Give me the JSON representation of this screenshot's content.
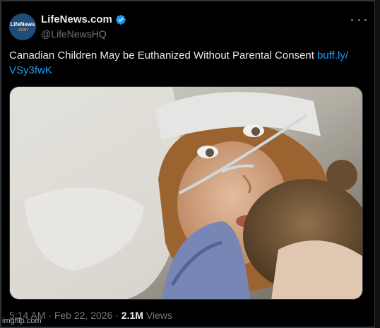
{
  "author": {
    "display_name": "LifeNews.com",
    "handle": "@LifeNewsHQ",
    "avatar_line1": "LifeNews",
    "avatar_line2": ".com",
    "verified_icon": "verified-badge-icon",
    "verified_color": "#1d9bf0"
  },
  "tweet": {
    "text": "Canadian Children May be Euthanized Without Parental Consent ",
    "link_text": "buff.ly/\nVSy3fwK",
    "link_color": "#1d9bf0",
    "time": "5:14 AM",
    "separator": "·",
    "date": "Feb 22, 2026",
    "views_count": "2.1M",
    "views_label": "Views"
  },
  "more_icon": "more-horizontal-icon",
  "watermark": "imgflip.com"
}
